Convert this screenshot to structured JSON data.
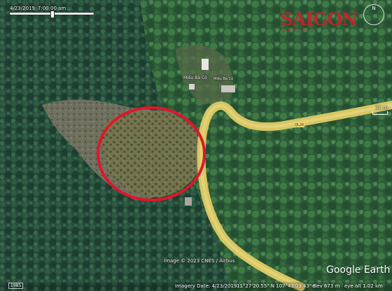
{
  "timeline": {
    "date": "4/23/2019",
    "time": "7:00:00 am"
  },
  "overlay_brand": {
    "main": "SAIGON",
    "sub": "ONLINE"
  },
  "compass": {
    "label": "N"
  },
  "scale": {
    "label": "31 m"
  },
  "places": [
    {
      "name": "Miếu Bà Cô"
    },
    {
      "name": "Miếu Bà Cô"
    }
  ],
  "road": {
    "label": "QL20"
  },
  "highlight": {
    "shape": "circle",
    "color": "#e0162b"
  },
  "credit": "Image © 2023 CNES / Airbus",
  "logo": "Google Earth",
  "status": {
    "year": "1985",
    "imagery_date": "Imagery Date: 4/23/2019",
    "coords": "11°27'20.55\" N   107°43'03.43\" E",
    "elev": "elev   673 m",
    "eye_alt": "eye alt   1.02 km"
  },
  "colors": {
    "road": "#d8c663",
    "circle": "#e0162b",
    "forest_dark": "#1f4a33",
    "clearing": "#6e6a4a"
  }
}
